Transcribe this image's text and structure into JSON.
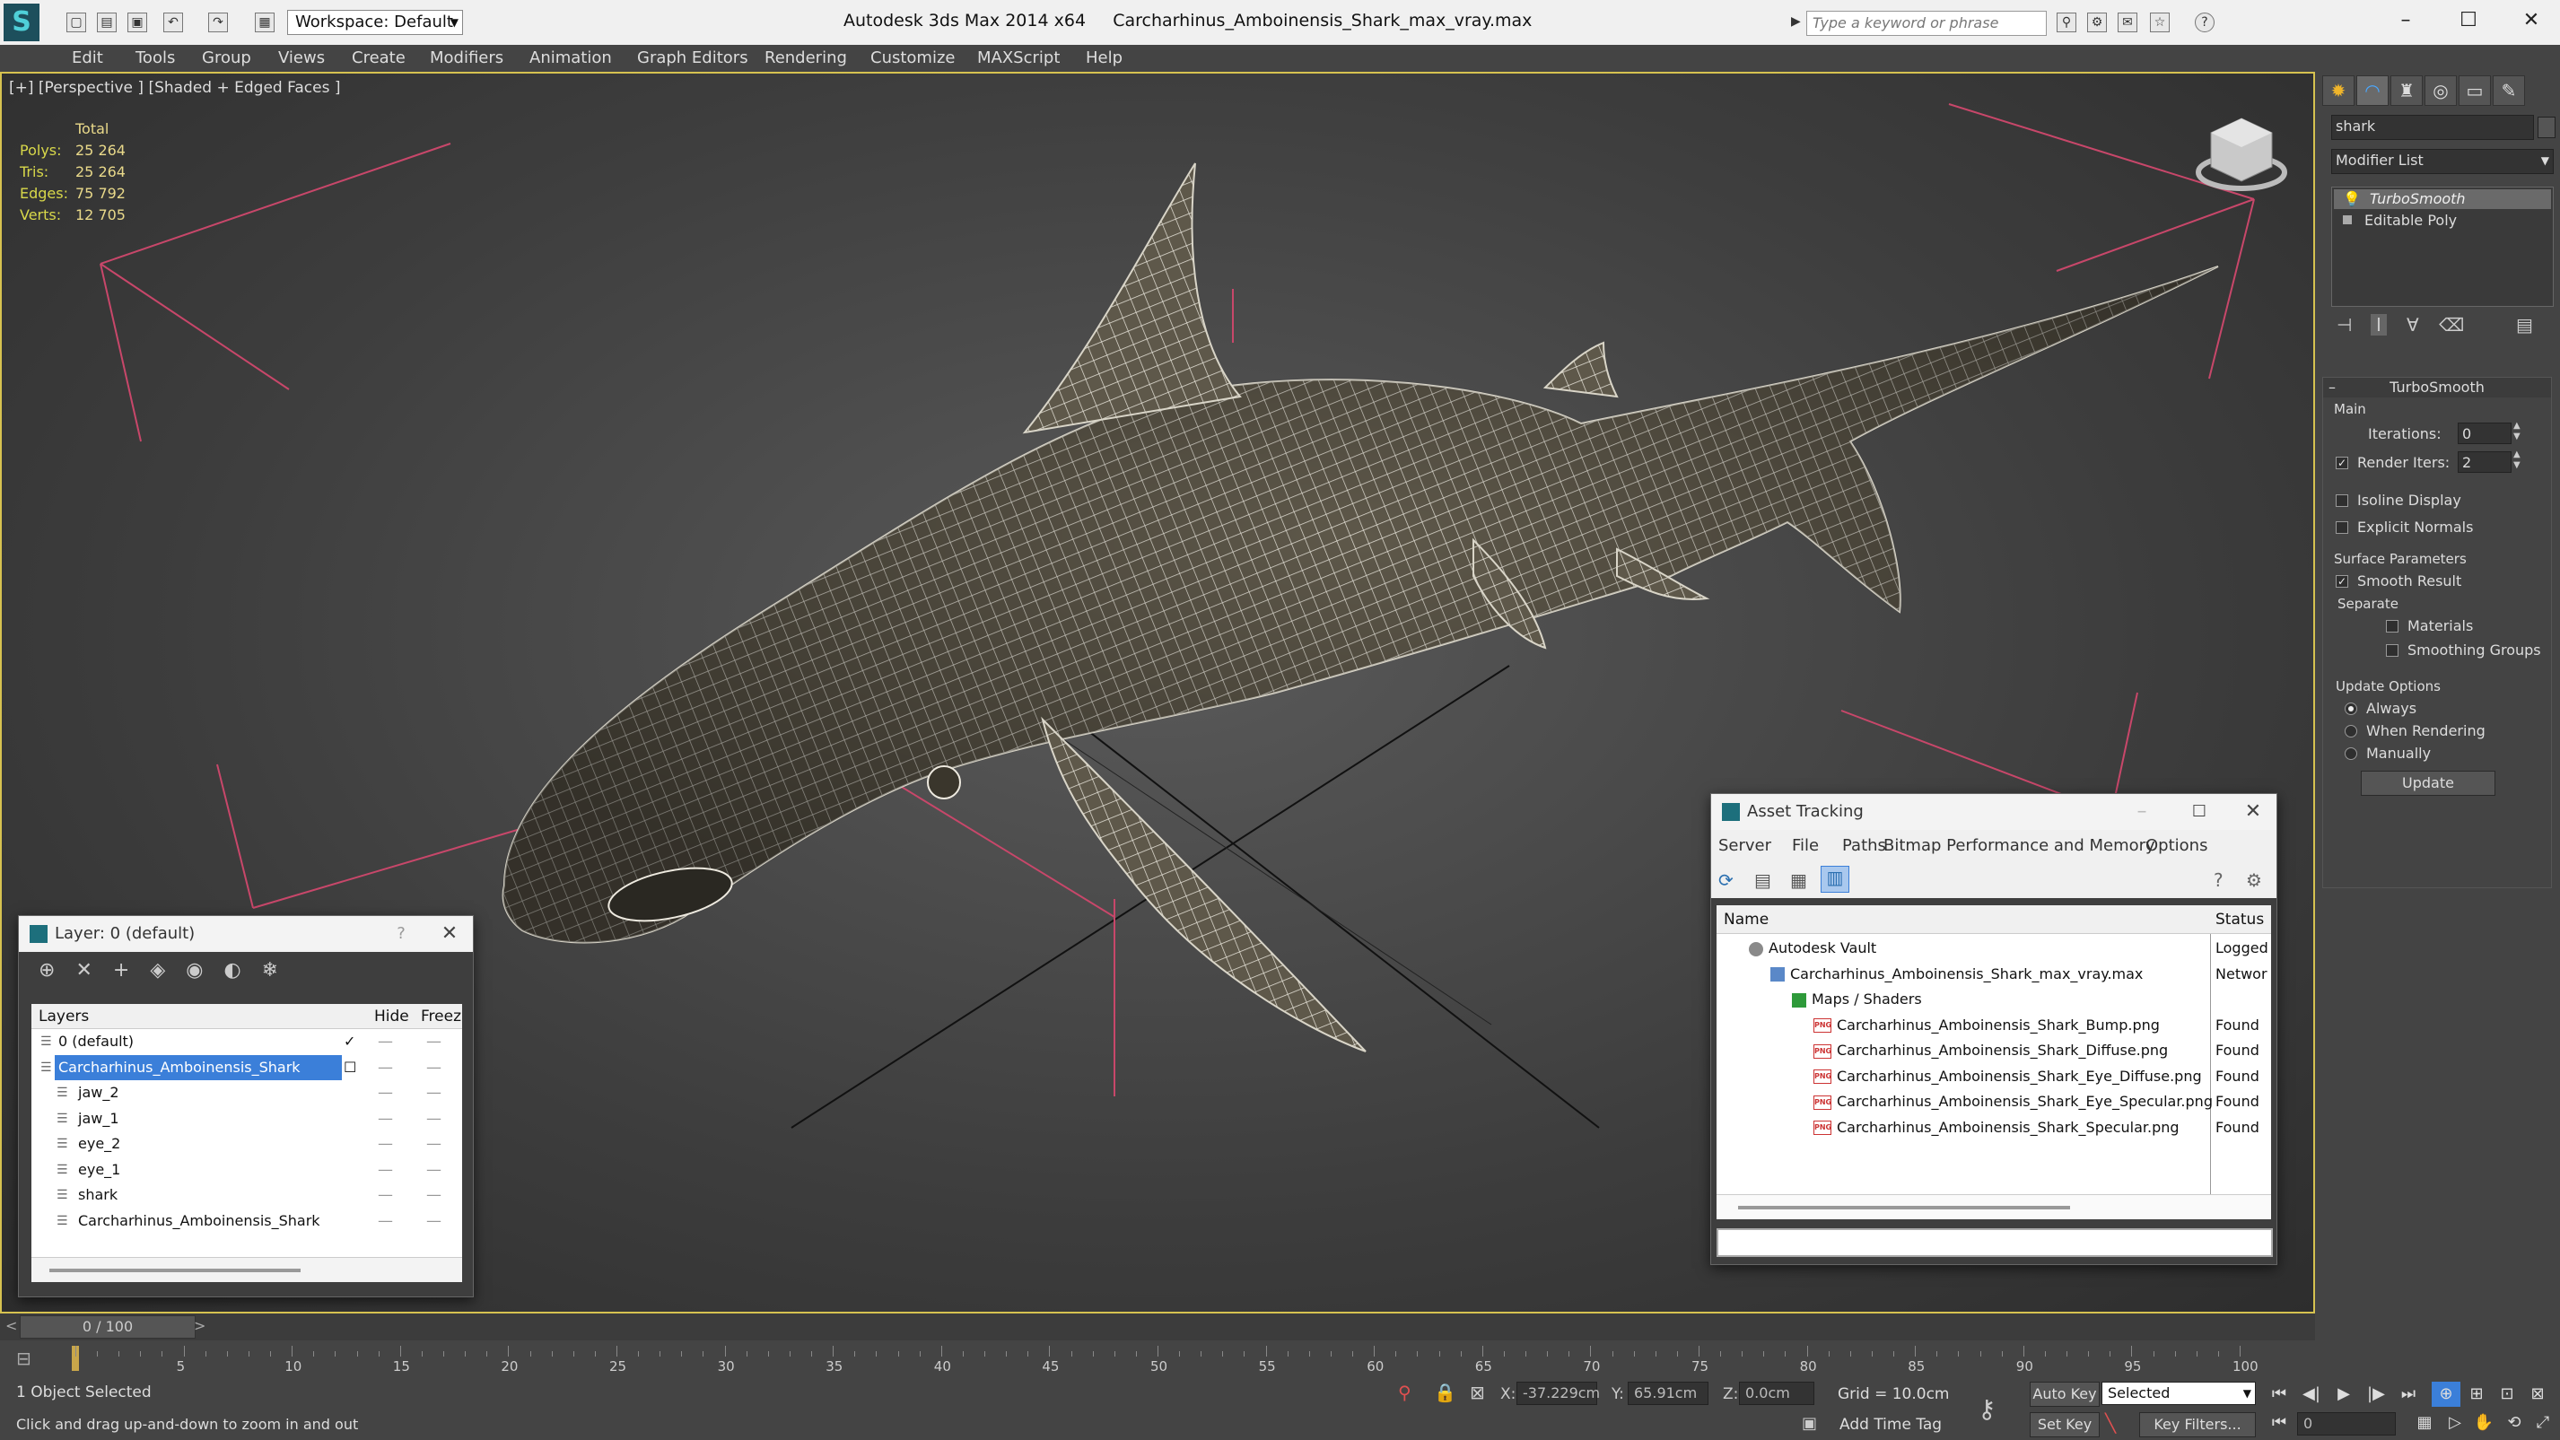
{
  "app": {
    "title_app": "Autodesk 3ds Max  2014 x64",
    "title_file": "Carcharhinus_Amboinensis_Shark_max_vray.max",
    "workspace": "Workspace: Default",
    "search_placeholder": "Type a keyword or phrase"
  },
  "menu": [
    "Edit",
    "Tools",
    "Group",
    "Views",
    "Create",
    "Modifiers",
    "Animation",
    "Graph Editors",
    "Rendering",
    "Customize",
    "MAXScript",
    "Help"
  ],
  "viewport": {
    "label": "[+] [Perspective ] [Shaded + Edged Faces ]",
    "stats_header": "Total",
    "stats": [
      {
        "label": "Polys:",
        "value": "25 264"
      },
      {
        "label": "Tris:",
        "value": "25 264"
      },
      {
        "label": "Edges:",
        "value": "75 792"
      },
      {
        "label": "Verts:",
        "value": "12 705"
      }
    ]
  },
  "command_panel": {
    "object_name": "shark",
    "modifier_list": "Modifier List",
    "stack": [
      "TurboSmooth",
      "Editable Poly"
    ],
    "rollout_title": "TurboSmooth",
    "main_label": "Main",
    "iterations_label": "Iterations:",
    "iterations_value": "0",
    "render_iters_label": "Render Iters:",
    "render_iters_value": "2",
    "render_iters_checked": true,
    "isoline_label": "Isoline Display",
    "explicit_normals_label": "Explicit Normals",
    "surface_params_label": "Surface Parameters",
    "smooth_result_label": "Smooth Result",
    "separate_label": "Separate",
    "materials_label": "Materials",
    "smoothing_groups_label": "Smoothing Groups",
    "update_options_label": "Update Options",
    "always_label": "Always",
    "when_rendering_label": "When Rendering",
    "manually_label": "Manually",
    "update_button": "Update"
  },
  "layer_window": {
    "title": "Layer: 0 (default)",
    "help": "?",
    "columns": {
      "layers": "Layers",
      "hide": "Hide",
      "freeze": "Freez"
    },
    "rows": [
      {
        "name": "0 (default)",
        "indent": 0,
        "checked": true,
        "selected": false
      },
      {
        "name": "Carcharhinus_Amboinensis_Shark",
        "indent": 0,
        "checked": false,
        "selected": true
      },
      {
        "name": "jaw_2",
        "indent": 1,
        "checked": false,
        "selected": false
      },
      {
        "name": "jaw_1",
        "indent": 1,
        "checked": false,
        "selected": false
      },
      {
        "name": "eye_2",
        "indent": 1,
        "checked": false,
        "selected": false
      },
      {
        "name": "eye_1",
        "indent": 1,
        "checked": false,
        "selected": false
      },
      {
        "name": "shark",
        "indent": 1,
        "checked": false,
        "selected": false
      },
      {
        "name": "Carcharhinus_Amboinensis_Shark",
        "indent": 1,
        "checked": false,
        "selected": false
      }
    ]
  },
  "asset_window": {
    "title": "Asset Tracking",
    "menu": [
      "Server",
      "File",
      "Paths",
      "Bitmap Performance and Memory",
      "Options"
    ],
    "columns": {
      "name": "Name",
      "status": "Status"
    },
    "rows": [
      {
        "name": "Autodesk Vault",
        "status": "Logged",
        "indent": 1,
        "kind": "vault"
      },
      {
        "name": "Carcharhinus_Amboinensis_Shark_max_vray.max",
        "status": "Networ",
        "indent": 2,
        "kind": "max"
      },
      {
        "name": "Maps / Shaders",
        "status": "",
        "indent": 3,
        "kind": "folder"
      },
      {
        "name": "Carcharhinus_Amboinensis_Shark_Bump.png",
        "status": "Found",
        "indent": 4,
        "kind": "png"
      },
      {
        "name": "Carcharhinus_Amboinensis_Shark_Diffuse.png",
        "status": "Found",
        "indent": 4,
        "kind": "png"
      },
      {
        "name": "Carcharhinus_Amboinensis_Shark_Eye_Diffuse.png",
        "status": "Found",
        "indent": 4,
        "kind": "png"
      },
      {
        "name": "Carcharhinus_Amboinensis_Shark_Eye_Specular.png",
        "status": "Found",
        "indent": 4,
        "kind": "png"
      },
      {
        "name": "Carcharhinus_Amboinensis_Shark_Specular.png",
        "status": "Found",
        "indent": 4,
        "kind": "png"
      }
    ]
  },
  "timeline": {
    "frame": "0 / 100",
    "ticks": [
      "5",
      "10",
      "15",
      "20",
      "25",
      "30",
      "35",
      "40",
      "45",
      "50",
      "55",
      "60",
      "65",
      "70",
      "75",
      "80",
      "85",
      "90",
      "95",
      "100"
    ]
  },
  "status": {
    "selection": "1 Object Selected",
    "prompt": "Click and drag up-and-down to zoom in and out",
    "x_label": "X:",
    "x_value": "-37.229cm",
    "y_label": "Y:",
    "y_value": "65.91cm",
    "z_label": "Z:",
    "z_value": "0.0cm",
    "grid": "Grid = 10.0cm",
    "add_time_tag": "Add Time Tag",
    "auto_key": "Auto Key",
    "set_key": "Set Key",
    "selected_dropdown": "Selected",
    "key_filters": "Key Filters...",
    "frame_value": "0"
  },
  "colors": {
    "viewport_border": "#d6c250",
    "selection": "#3b7fd9",
    "stats": "#d8d84a"
  }
}
